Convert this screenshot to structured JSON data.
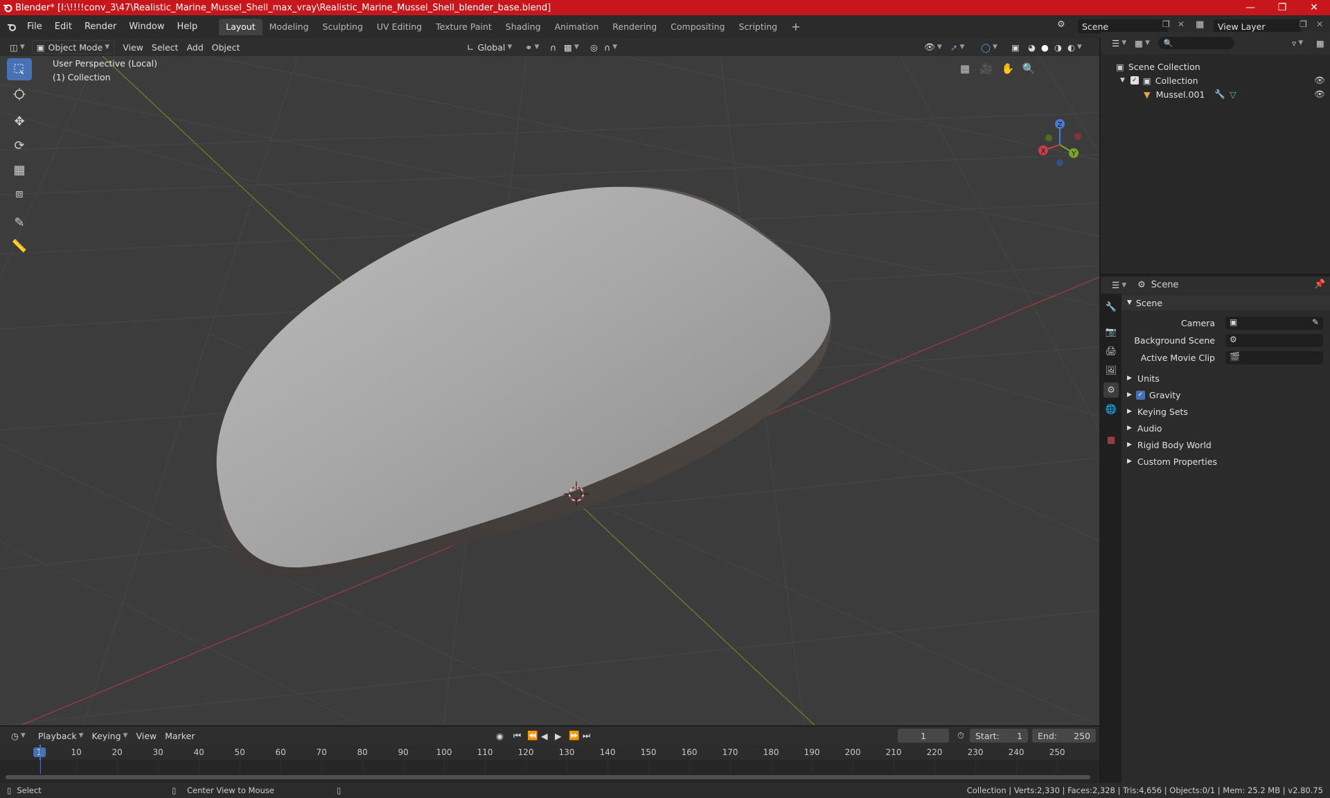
{
  "window": {
    "title": "Blender* [I:\\!!!!conv_3\\47\\Realistic_Marine_Mussel_Shell_max_vray\\Realistic_Marine_Mussel_Shell_blender_base.blend]",
    "accent": "#c8161d"
  },
  "menu": [
    "File",
    "Edit",
    "Render",
    "Window",
    "Help"
  ],
  "workspaces": [
    "Layout",
    "Modeling",
    "Sculpting",
    "UV Editing",
    "Texture Paint",
    "Shading",
    "Animation",
    "Rendering",
    "Compositing",
    "Scripting"
  ],
  "active_workspace": "Layout",
  "scene_name": "Scene",
  "view_layer": "View Layer",
  "viewport_header": {
    "mode": "Object Mode",
    "menus": [
      "View",
      "Select",
      "Add",
      "Object"
    ],
    "orientation": "Global"
  },
  "viewport": {
    "perspective": "User Perspective (Local)",
    "collection": "(1) Collection",
    "gizmo": {
      "x": "X",
      "y": "Y",
      "z": "Z"
    },
    "tools": [
      "select-box-icon",
      "cursor-icon",
      "move-icon",
      "rotate-icon",
      "scale-icon",
      "transform-icon",
      "annotate-icon",
      "measure-icon"
    ]
  },
  "outliner": {
    "root": "Scene Collection",
    "collection": "Collection",
    "object": "Mussel.001"
  },
  "properties": {
    "context": "Scene",
    "panel": "Scene",
    "fields": {
      "camera": "Camera",
      "background_scene": "Background Scene",
      "active_movie_clip": "Active Movie Clip"
    },
    "sections": [
      "Units",
      "Gravity",
      "Keying Sets",
      "Audio",
      "Rigid Body World",
      "Custom Properties"
    ]
  },
  "timeline": {
    "menus": [
      "Playback",
      "Keying",
      "View",
      "Marker"
    ],
    "current_frame": "1",
    "start_label": "Start:",
    "start": "1",
    "end_label": "End:",
    "end": "250",
    "ticks": [
      "1",
      "10",
      "20",
      "30",
      "40",
      "50",
      "60",
      "70",
      "80",
      "90",
      "100",
      "110",
      "120",
      "130",
      "140",
      "150",
      "160",
      "170",
      "180",
      "190",
      "200",
      "210",
      "220",
      "230",
      "240",
      "250"
    ]
  },
  "statusbar": {
    "select": "Select",
    "center": "Center View to Mouse",
    "stats": "Collection | Verts:2,330 | Faces:2,328 | Tris:4,656 | Objects:0/1 | Mem: 25.2 MB | v2.80.75"
  }
}
